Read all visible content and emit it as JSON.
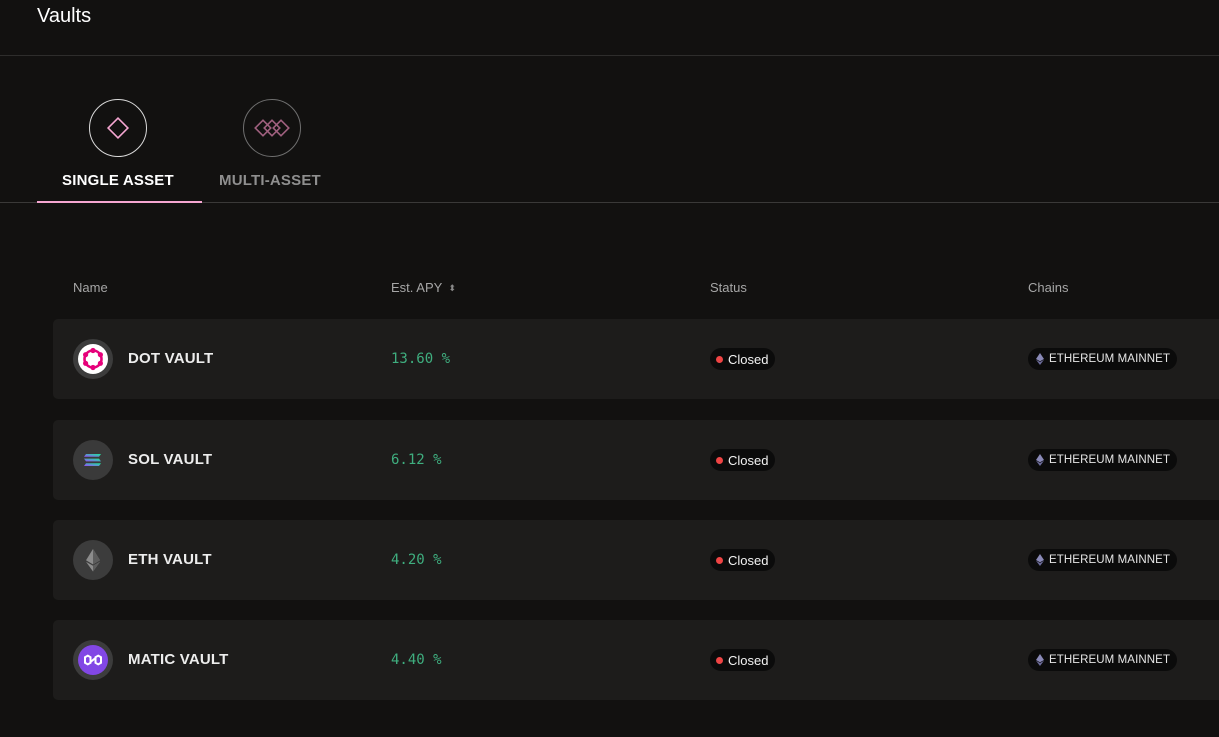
{
  "header": {
    "title": "Vaults"
  },
  "tabs": [
    {
      "label": "SINGLE ASSET",
      "active": true,
      "icon": "diamond-icon"
    },
    {
      "label": "MULTI-ASSET",
      "active": false,
      "icon": "multi-diamond-icon"
    }
  ],
  "table": {
    "columns": {
      "name": "Name",
      "apy": "Est. APY",
      "status": "Status",
      "chains": "Chains"
    },
    "rows": [
      {
        "name": "DOT VAULT",
        "apy": "13.60 %",
        "status": "Closed",
        "chain": "ETHEREUM MAINNET",
        "icon": "polkadot-icon"
      },
      {
        "name": "SOL VAULT",
        "apy": "6.12 %",
        "status": "Closed",
        "chain": "ETHEREUM MAINNET",
        "icon": "solana-icon"
      },
      {
        "name": "ETH VAULT",
        "apy": "4.20 %",
        "status": "Closed",
        "chain": "ETHEREUM MAINNET",
        "icon": "ethereum-icon"
      },
      {
        "name": "MATIC VAULT",
        "apy": "4.40 %",
        "status": "Closed",
        "chain": "ETHEREUM MAINNET",
        "icon": "polygon-icon"
      }
    ]
  },
  "colors": {
    "background": "#121110",
    "row_background": "#1d1c1b",
    "accent_pink": "#f5a6d1",
    "apy_green": "#3fae7f",
    "status_closed": "#ef4444"
  }
}
